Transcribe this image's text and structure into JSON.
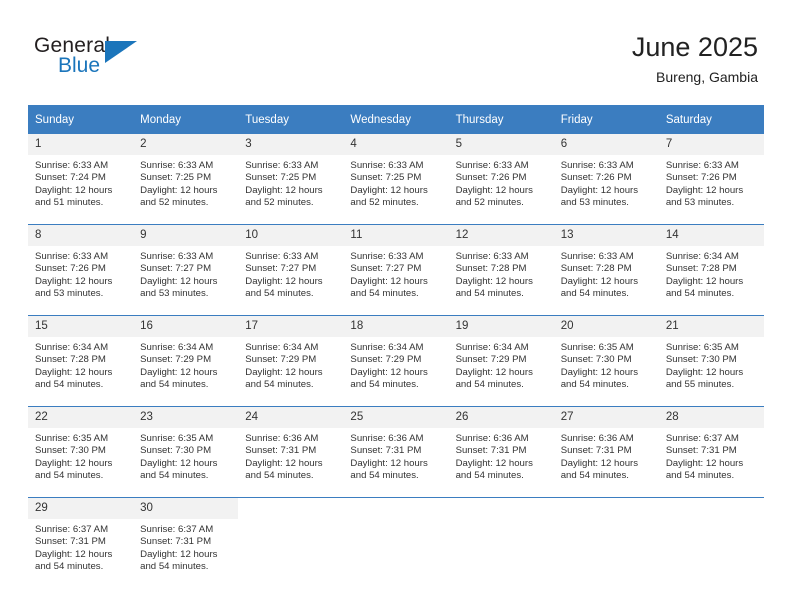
{
  "brand": {
    "name_part1": "General",
    "name_part2": "Blue",
    "triangle_icon": "triangle-icon",
    "color_dark": "#231f20",
    "color_blue": "#1b75bb"
  },
  "header": {
    "title": "June 2025",
    "subtitle": "Bureng, Gambia"
  },
  "theme": {
    "header_row_bg": "#3b7dc0",
    "daynum_bg": "#f2f2f2",
    "text": "#333333"
  },
  "columns": [
    "Sunday",
    "Monday",
    "Tuesday",
    "Wednesday",
    "Thursday",
    "Friday",
    "Saturday"
  ],
  "labels": {
    "sunrise": "Sunrise:",
    "sunset": "Sunset:",
    "daylight": "Daylight:"
  },
  "weeks": [
    [
      {
        "day": "1",
        "sunrise": "Sunrise: 6:33 AM",
        "sunset": "Sunset: 7:24 PM",
        "daylight": "Daylight: 12 hours and 51 minutes."
      },
      {
        "day": "2",
        "sunrise": "Sunrise: 6:33 AM",
        "sunset": "Sunset: 7:25 PM",
        "daylight": "Daylight: 12 hours and 52 minutes."
      },
      {
        "day": "3",
        "sunrise": "Sunrise: 6:33 AM",
        "sunset": "Sunset: 7:25 PM",
        "daylight": "Daylight: 12 hours and 52 minutes."
      },
      {
        "day": "4",
        "sunrise": "Sunrise: 6:33 AM",
        "sunset": "Sunset: 7:25 PM",
        "daylight": "Daylight: 12 hours and 52 minutes."
      },
      {
        "day": "5",
        "sunrise": "Sunrise: 6:33 AM",
        "sunset": "Sunset: 7:26 PM",
        "daylight": "Daylight: 12 hours and 52 minutes."
      },
      {
        "day": "6",
        "sunrise": "Sunrise: 6:33 AM",
        "sunset": "Sunset: 7:26 PM",
        "daylight": "Daylight: 12 hours and 53 minutes."
      },
      {
        "day": "7",
        "sunrise": "Sunrise: 6:33 AM",
        "sunset": "Sunset: 7:26 PM",
        "daylight": "Daylight: 12 hours and 53 minutes."
      }
    ],
    [
      {
        "day": "8",
        "sunrise": "Sunrise: 6:33 AM",
        "sunset": "Sunset: 7:26 PM",
        "daylight": "Daylight: 12 hours and 53 minutes."
      },
      {
        "day": "9",
        "sunrise": "Sunrise: 6:33 AM",
        "sunset": "Sunset: 7:27 PM",
        "daylight": "Daylight: 12 hours and 53 minutes."
      },
      {
        "day": "10",
        "sunrise": "Sunrise: 6:33 AM",
        "sunset": "Sunset: 7:27 PM",
        "daylight": "Daylight: 12 hours and 54 minutes."
      },
      {
        "day": "11",
        "sunrise": "Sunrise: 6:33 AM",
        "sunset": "Sunset: 7:27 PM",
        "daylight": "Daylight: 12 hours and 54 minutes."
      },
      {
        "day": "12",
        "sunrise": "Sunrise: 6:33 AM",
        "sunset": "Sunset: 7:28 PM",
        "daylight": "Daylight: 12 hours and 54 minutes."
      },
      {
        "day": "13",
        "sunrise": "Sunrise: 6:33 AM",
        "sunset": "Sunset: 7:28 PM",
        "daylight": "Daylight: 12 hours and 54 minutes."
      },
      {
        "day": "14",
        "sunrise": "Sunrise: 6:34 AM",
        "sunset": "Sunset: 7:28 PM",
        "daylight": "Daylight: 12 hours and 54 minutes."
      }
    ],
    [
      {
        "day": "15",
        "sunrise": "Sunrise: 6:34 AM",
        "sunset": "Sunset: 7:28 PM",
        "daylight": "Daylight: 12 hours and 54 minutes."
      },
      {
        "day": "16",
        "sunrise": "Sunrise: 6:34 AM",
        "sunset": "Sunset: 7:29 PM",
        "daylight": "Daylight: 12 hours and 54 minutes."
      },
      {
        "day": "17",
        "sunrise": "Sunrise: 6:34 AM",
        "sunset": "Sunset: 7:29 PM",
        "daylight": "Daylight: 12 hours and 54 minutes."
      },
      {
        "day": "18",
        "sunrise": "Sunrise: 6:34 AM",
        "sunset": "Sunset: 7:29 PM",
        "daylight": "Daylight: 12 hours and 54 minutes."
      },
      {
        "day": "19",
        "sunrise": "Sunrise: 6:34 AM",
        "sunset": "Sunset: 7:29 PM",
        "daylight": "Daylight: 12 hours and 54 minutes."
      },
      {
        "day": "20",
        "sunrise": "Sunrise: 6:35 AM",
        "sunset": "Sunset: 7:30 PM",
        "daylight": "Daylight: 12 hours and 54 minutes."
      },
      {
        "day": "21",
        "sunrise": "Sunrise: 6:35 AM",
        "sunset": "Sunset: 7:30 PM",
        "daylight": "Daylight: 12 hours and 55 minutes."
      }
    ],
    [
      {
        "day": "22",
        "sunrise": "Sunrise: 6:35 AM",
        "sunset": "Sunset: 7:30 PM",
        "daylight": "Daylight: 12 hours and 54 minutes."
      },
      {
        "day": "23",
        "sunrise": "Sunrise: 6:35 AM",
        "sunset": "Sunset: 7:30 PM",
        "daylight": "Daylight: 12 hours and 54 minutes."
      },
      {
        "day": "24",
        "sunrise": "Sunrise: 6:36 AM",
        "sunset": "Sunset: 7:31 PM",
        "daylight": "Daylight: 12 hours and 54 minutes."
      },
      {
        "day": "25",
        "sunrise": "Sunrise: 6:36 AM",
        "sunset": "Sunset: 7:31 PM",
        "daylight": "Daylight: 12 hours and 54 minutes."
      },
      {
        "day": "26",
        "sunrise": "Sunrise: 6:36 AM",
        "sunset": "Sunset: 7:31 PM",
        "daylight": "Daylight: 12 hours and 54 minutes."
      },
      {
        "day": "27",
        "sunrise": "Sunrise: 6:36 AM",
        "sunset": "Sunset: 7:31 PM",
        "daylight": "Daylight: 12 hours and 54 minutes."
      },
      {
        "day": "28",
        "sunrise": "Sunrise: 6:37 AM",
        "sunset": "Sunset: 7:31 PM",
        "daylight": "Daylight: 12 hours and 54 minutes."
      }
    ],
    [
      {
        "day": "29",
        "sunrise": "Sunrise: 6:37 AM",
        "sunset": "Sunset: 7:31 PM",
        "daylight": "Daylight: 12 hours and 54 minutes."
      },
      {
        "day": "30",
        "sunrise": "Sunrise: 6:37 AM",
        "sunset": "Sunset: 7:31 PM",
        "daylight": "Daylight: 12 hours and 54 minutes."
      },
      {
        "day": "",
        "sunrise": "",
        "sunset": "",
        "daylight": ""
      },
      {
        "day": "",
        "sunrise": "",
        "sunset": "",
        "daylight": ""
      },
      {
        "day": "",
        "sunrise": "",
        "sunset": "",
        "daylight": ""
      },
      {
        "day": "",
        "sunrise": "",
        "sunset": "",
        "daylight": ""
      },
      {
        "day": "",
        "sunrise": "",
        "sunset": "",
        "daylight": ""
      }
    ]
  ]
}
